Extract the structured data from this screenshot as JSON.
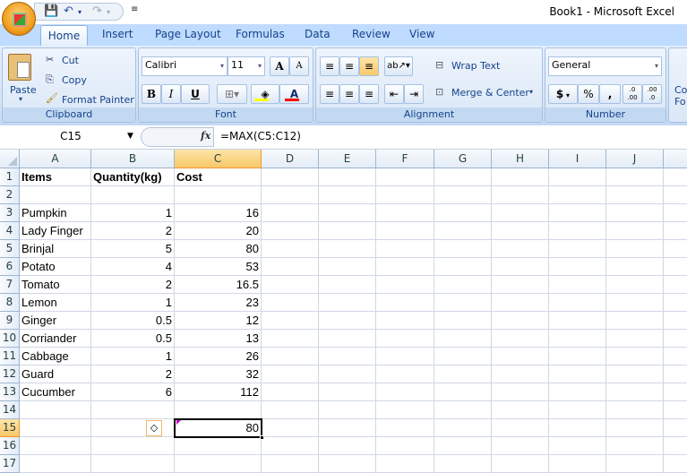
{
  "window": {
    "title": "Book1 - Microsoft Excel"
  },
  "tabs": [
    "Home",
    "Insert",
    "Page Layout",
    "Formulas",
    "Data",
    "Review",
    "View"
  ],
  "ribbon": {
    "clipboard": {
      "label": "Clipboard",
      "paste": "Paste",
      "cut": "Cut",
      "copy": "Copy",
      "format_painter": "Format Painter"
    },
    "font": {
      "label": "Font",
      "name": "Calibri",
      "size": "11",
      "bold": "B",
      "italic": "I",
      "underline": "U",
      "grow": "A",
      "shrink": "A",
      "color": "A",
      "fill_color": "#ffff00",
      "font_color": "#ff0000"
    },
    "alignment": {
      "label": "Alignment",
      "wrap_text": "Wrap Text",
      "merge_center": "Merge & Center"
    },
    "number": {
      "label": "Number",
      "format": "General",
      "currency": "$",
      "percent": "%",
      "comma": ",",
      "inc_decimal": ".0 .00",
      "dec_decimal": ".00 .0"
    },
    "styles": {
      "partial": "Co Fo"
    }
  },
  "formula_bar": {
    "name_box": "C15",
    "fx": "fx",
    "formula": "=MAX(C5:C12)"
  },
  "columns": [
    "A",
    "B",
    "C",
    "D",
    "E",
    "F",
    "G",
    "H",
    "I",
    "J"
  ],
  "selected": {
    "column": "C",
    "row": 15
  },
  "rows": [
    [
      "Items",
      "Quantity(kg)",
      "Cost"
    ],
    [
      "",
      "",
      ""
    ],
    [
      "Pumpkin",
      "1",
      "16"
    ],
    [
      "Lady Finger",
      "2",
      "20"
    ],
    [
      "Brinjal",
      "5",
      "80"
    ],
    [
      "Potato",
      "4",
      "53"
    ],
    [
      "Tomato",
      "2",
      "16.5"
    ],
    [
      "Lemon",
      "1",
      "23"
    ],
    [
      "Ginger",
      "0.5",
      "12"
    ],
    [
      "Corriander",
      "0.5",
      "13"
    ],
    [
      "Cabbage",
      "1",
      "26"
    ],
    [
      "Guard",
      "2",
      "32"
    ],
    [
      "Cucumber",
      "6",
      "112"
    ],
    [
      "",
      "",
      ""
    ],
    [
      "",
      "",
      "80"
    ],
    [
      "",
      "",
      ""
    ],
    [
      "",
      "",
      ""
    ]
  ]
}
